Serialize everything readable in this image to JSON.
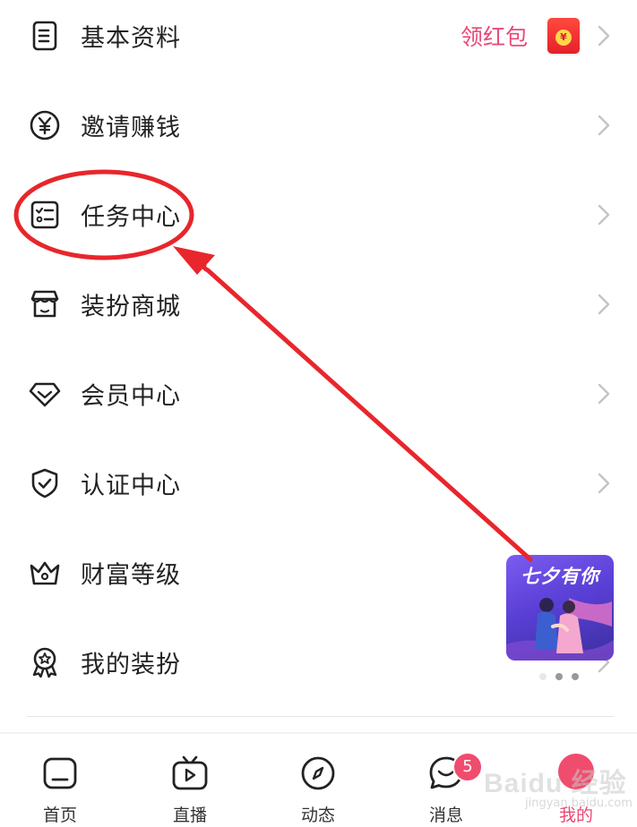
{
  "menu": {
    "items": [
      {
        "label": "基本资料",
        "icon": "document-icon",
        "extra_label": "领红包",
        "extra_icon": "red-packet-icon"
      },
      {
        "label": "邀请赚钱",
        "icon": "yen-coin-icon"
      },
      {
        "label": "任务中心",
        "icon": "task-checklist-icon"
      },
      {
        "label": "装扮商城",
        "icon": "shop-icon"
      },
      {
        "label": "会员中心",
        "icon": "diamond-icon"
      },
      {
        "label": "认证中心",
        "icon": "shield-check-icon"
      },
      {
        "label": "财富等级",
        "icon": "crown-icon"
      },
      {
        "label": "我的装扮",
        "icon": "badge-ribbon-icon"
      }
    ],
    "red_packet_coin": "¥"
  },
  "promo": {
    "title": "七夕有你"
  },
  "tabbar": {
    "tabs": [
      {
        "label": "首页",
        "icon": "home-icon"
      },
      {
        "label": "直播",
        "icon": "tv-play-icon"
      },
      {
        "label": "动态",
        "icon": "compass-icon"
      },
      {
        "label": "消息",
        "icon": "chat-bubble-icon",
        "badge": "5"
      },
      {
        "label": "我的",
        "icon": "profile-icon",
        "active": true
      }
    ]
  },
  "watermark": {
    "text": "Baidu 经验",
    "subtext": "jingyan.baidu.com"
  },
  "colors": {
    "accent": "#e84a77",
    "annotation_red": "#e8262c",
    "badge": "#f04c6e"
  }
}
